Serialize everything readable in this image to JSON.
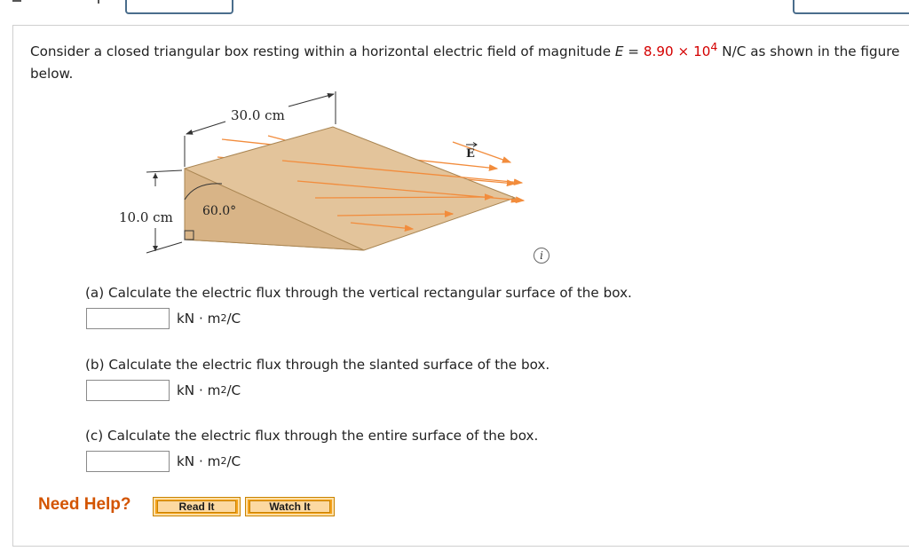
{
  "intro": {
    "before": "Consider a closed triangular box resting within a horizontal electric field of magnitude ",
    "var": "E",
    "equals": " = ",
    "value": "8.90 × 10",
    "exponent": "4",
    "after": " N/C as shown in the figure below."
  },
  "figure": {
    "width_label": "30.0 cm",
    "height_label": "10.0 cm",
    "angle_label": "60.0°",
    "field_label": "E"
  },
  "questions": [
    {
      "label": "(a) Calculate the electric flux through the vertical rectangular surface of the box.",
      "value": "",
      "unit_prefix": "kN · m",
      "unit_exp": "2",
      "unit_suffix": "/C"
    },
    {
      "label": "(b) Calculate the electric flux through the slanted surface of the box.",
      "value": "",
      "unit_prefix": "kN · m",
      "unit_exp": "2",
      "unit_suffix": "/C"
    },
    {
      "label": "(c) Calculate the electric flux through the entire surface of the box.",
      "value": "",
      "unit_prefix": "kN · m",
      "unit_exp": "2",
      "unit_suffix": "/C"
    }
  ],
  "help": {
    "label": "Need Help?",
    "read_it": "Read It",
    "watch_it": "Watch It"
  },
  "colors": {
    "highlight": "#d40000",
    "arrow": "#f28c3c",
    "box_top": "#e7c9a1",
    "box_side": "#d4b084",
    "need_help": "#d35400",
    "button": "#f4a21c"
  }
}
